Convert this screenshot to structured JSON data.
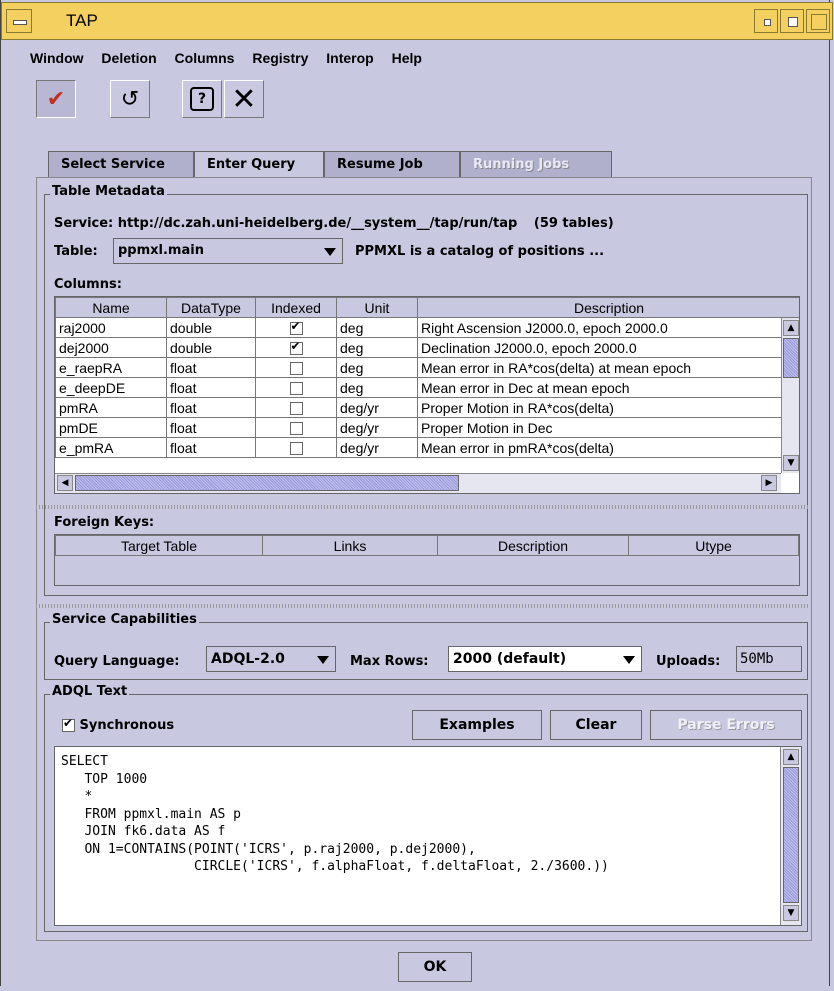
{
  "window": {
    "title": "TAP"
  },
  "menu": [
    "Window",
    "Deletion",
    "Columns",
    "Registry",
    "Interop",
    "Help"
  ],
  "toolbar": {
    "icons": [
      "pin-icon",
      "reload-icon",
      "help-icon",
      "close-icon"
    ]
  },
  "tabs": [
    {
      "label": "Select Service",
      "state": "normal"
    },
    {
      "label": "Enter Query",
      "state": "active"
    },
    {
      "label": "Resume Job",
      "state": "normal"
    },
    {
      "label": "Running Jobs",
      "state": "disabled"
    }
  ],
  "metadata": {
    "legend": "Table Metadata",
    "service_label": "Service:",
    "service_url": "http://dc.zah.uni-heidelberg.de/__system__/tap/run/tap",
    "table_count": "(59 tables)",
    "table_label": "Table:",
    "table_value": "ppmxl.main",
    "table_desc": "PPMXL is a catalog of positions ...",
    "columns_label": "Columns:",
    "columns_headers": [
      "Name",
      "DataType",
      "Indexed",
      "Unit",
      "Description"
    ],
    "columns_rows": [
      {
        "name": "raj2000",
        "type": "double",
        "indexed": true,
        "unit": "deg",
        "desc": "Right Ascension J2000.0, epoch 2000.0"
      },
      {
        "name": "dej2000",
        "type": "double",
        "indexed": true,
        "unit": "deg",
        "desc": "Declination J2000.0, epoch 2000.0"
      },
      {
        "name": "e_raepRA",
        "type": "float",
        "indexed": false,
        "unit": "deg",
        "desc": "Mean error in RA*cos(delta) at mean epoch"
      },
      {
        "name": "e_deepDE",
        "type": "float",
        "indexed": false,
        "unit": "deg",
        "desc": "Mean error in Dec at mean epoch"
      },
      {
        "name": "pmRA",
        "type": "float",
        "indexed": false,
        "unit": "deg/yr",
        "desc": "Proper Motion in RA*cos(delta)"
      },
      {
        "name": "pmDE",
        "type": "float",
        "indexed": false,
        "unit": "deg/yr",
        "desc": "Proper Motion in Dec"
      },
      {
        "name": "e_pmRA",
        "type": "float",
        "indexed": false,
        "unit": "deg/yr",
        "desc": "Mean error in pmRA*cos(delta)"
      }
    ],
    "fk_label": "Foreign Keys:",
    "fk_headers": [
      "Target Table",
      "Links",
      "Description",
      "Utype"
    ]
  },
  "capabilities": {
    "legend": "Service Capabilities",
    "lang_label": "Query Language:",
    "lang_value": "ADQL-2.0",
    "maxrows_label": "Max Rows:",
    "maxrows_value": "2000 (default)",
    "uploads_label": "Uploads:",
    "uploads_value": "50Mb"
  },
  "adql": {
    "legend": "ADQL Text",
    "sync_label": "Synchronous",
    "sync_checked": true,
    "examples_label": "Examples",
    "clear_label": "Clear",
    "parse_label": "Parse Errors",
    "text": "SELECT\n   TOP 1000\n   *\n   FROM ppmxl.main AS p\n   JOIN fk6.data AS f\n   ON 1=CONTAINS(POINT('ICRS', p.raj2000, p.dej2000),\n                 CIRCLE('ICRS', f.alphaFloat, f.deltaFloat, 2./3600.))"
  },
  "ok_label": "OK"
}
